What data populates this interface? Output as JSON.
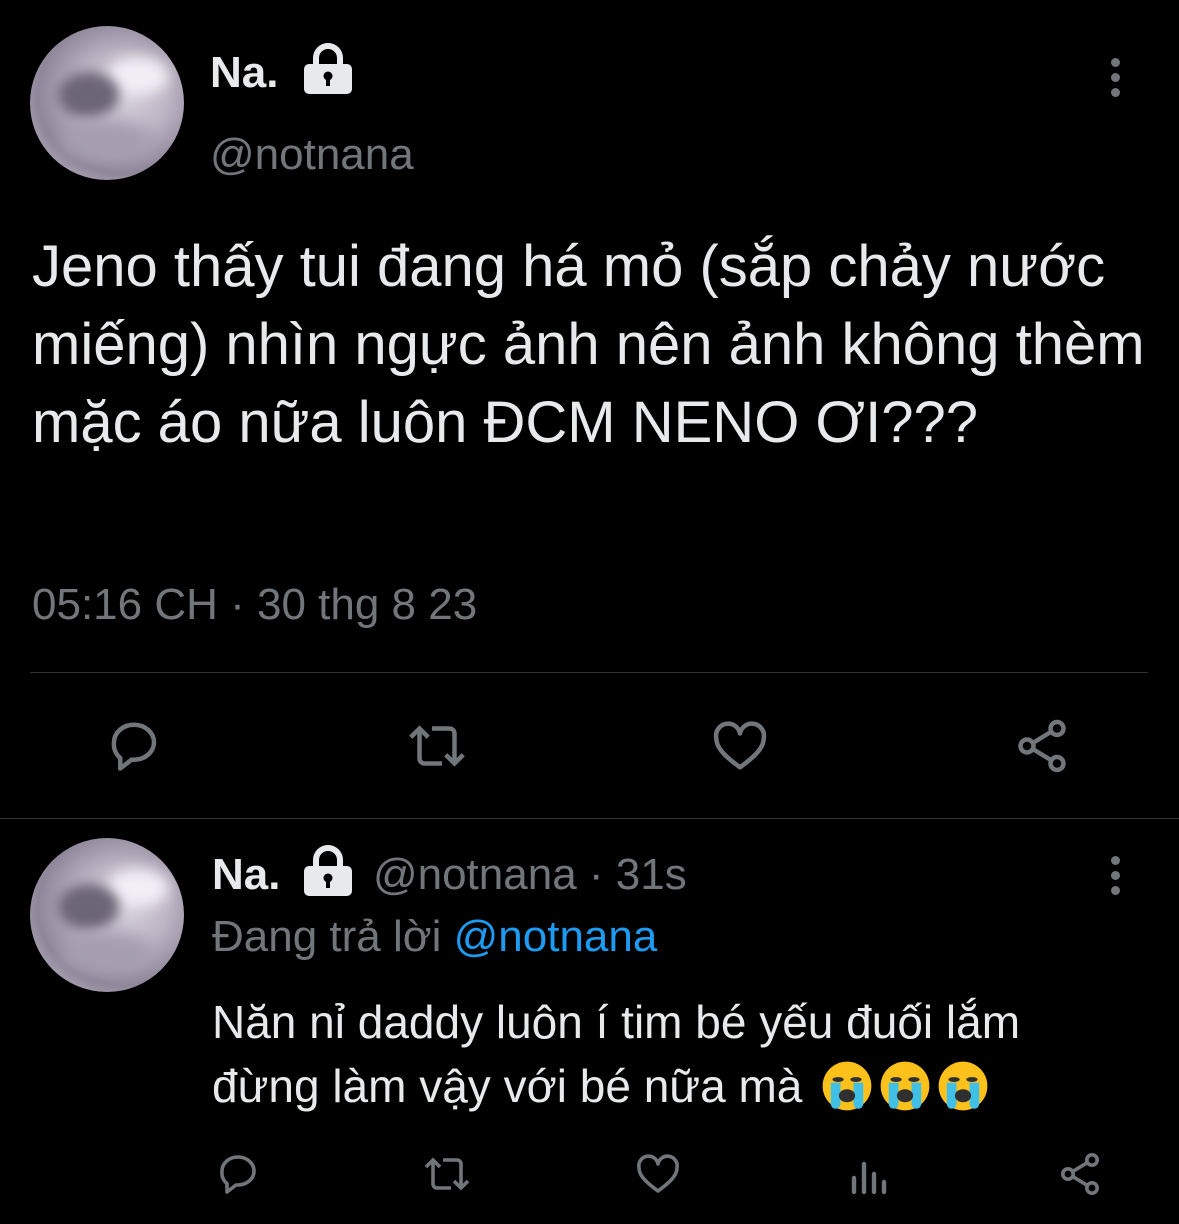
{
  "main_tweet": {
    "display_name": "Na.",
    "handle": "@notnana",
    "text": "Jeno thấy tui đang há mỏ (sắp chảy nước miếng) nhìn ngực ảnh nên ảnh không thèm mặc áo nữa luôn ĐCM NENO ƠI???",
    "timestamp": "05:16 CH · 30 thg 8 23",
    "locked_icon": "lock-icon",
    "actions": [
      "reply-icon",
      "retweet-icon",
      "like-icon",
      "share-icon"
    ]
  },
  "reply_tweet": {
    "display_name": "Na.",
    "handle": "@notnana",
    "separator": "·",
    "age": "31s",
    "replying_prefix": "Đang trả lời",
    "replying_to": "@notnana",
    "text_line1": "Năn nỉ daddy luôn í tim bé yếu đuối lắm",
    "text_line2": "đừng làm vậy với bé nữa mà",
    "emojis": [
      "😭",
      "😭",
      "😭"
    ],
    "actions": [
      "reply-icon",
      "retweet-icon",
      "like-icon",
      "views-icon",
      "share-icon"
    ]
  },
  "colors": {
    "background": "#000000",
    "text": "#e7e9ea",
    "secondary": "#71767b",
    "link": "#1d9bf0",
    "divider": "#2f3336"
  }
}
